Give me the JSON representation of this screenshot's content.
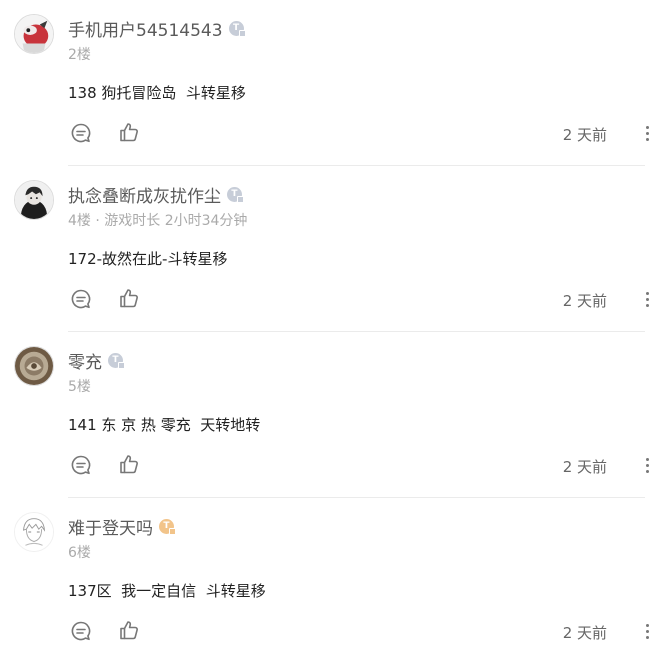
{
  "comments": [
    {
      "username": "手机用户54514543",
      "level_badge": "T",
      "floor": "2楼",
      "text": "138 狗托冒险岛  斗转星移",
      "time": "2 天前",
      "avatar": "red-character-avatar"
    },
    {
      "username": "执念叠断成灰扰作尘",
      "level_badge": "T",
      "floor": "4楼 · 游戏时长 2小时34分钟",
      "text": "172-故然在此-斗转星移",
      "time": "2 天前",
      "avatar": "dark-character-avatar"
    },
    {
      "username": "零充",
      "level_badge": "T",
      "floor": "5楼",
      "text": "141 东 京 热 零充  天转地转",
      "time": "2 天前",
      "avatar": "stone-emblem-avatar"
    },
    {
      "username": "难于登天吗",
      "level_badge": "T",
      "floor": "6楼",
      "text": "137区  我一定自信  斗转星移",
      "time": "2 天前",
      "avatar": "anime-sketch-avatar"
    }
  ],
  "colors": {
    "badge_default": "#c7cdd8",
    "badge_gold": "#f2c48a",
    "divider": "#ebebeb",
    "icon": "#777777"
  },
  "icons": {
    "reply": "comment-bubble-icon",
    "like": "thumbs-up-icon",
    "more": "vertical-ellipsis-icon",
    "badge": "level-badge-icon"
  }
}
